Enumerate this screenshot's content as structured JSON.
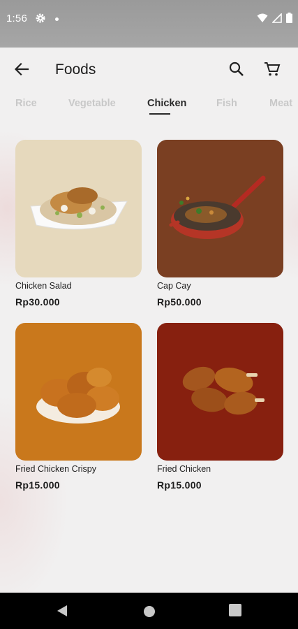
{
  "status_bar": {
    "time": "1:56"
  },
  "app_bar": {
    "title": "Foods"
  },
  "tabs": [
    {
      "label": "Rice",
      "active": false
    },
    {
      "label": "Vegetable",
      "active": false
    },
    {
      "label": "Chicken",
      "active": true
    },
    {
      "label": "Fish",
      "active": false
    },
    {
      "label": "Meat",
      "active": false
    }
  ],
  "products": [
    {
      "name": "Chicken Salad",
      "price": "Rp30.000",
      "bg_color": "#e6d9bd",
      "icon": "salad-plate-image"
    },
    {
      "name": "Cap Cay",
      "price": "Rp50.000",
      "bg_color": "#7a3f22",
      "icon": "frying-pan-image"
    },
    {
      "name": "Fried Chicken Crispy",
      "price": "Rp15.000",
      "bg_color": "#c9781c",
      "icon": "fried-chicken-plate-image"
    },
    {
      "name": "Fried Chicken",
      "price": "Rp15.000",
      "bg_color": "#87200f",
      "icon": "chicken-drumsticks-image"
    }
  ],
  "colors": {
    "active_tab": "#2a2a2a",
    "inactive_tab": "#c8c8c8",
    "text": "#1d1d1d"
  }
}
